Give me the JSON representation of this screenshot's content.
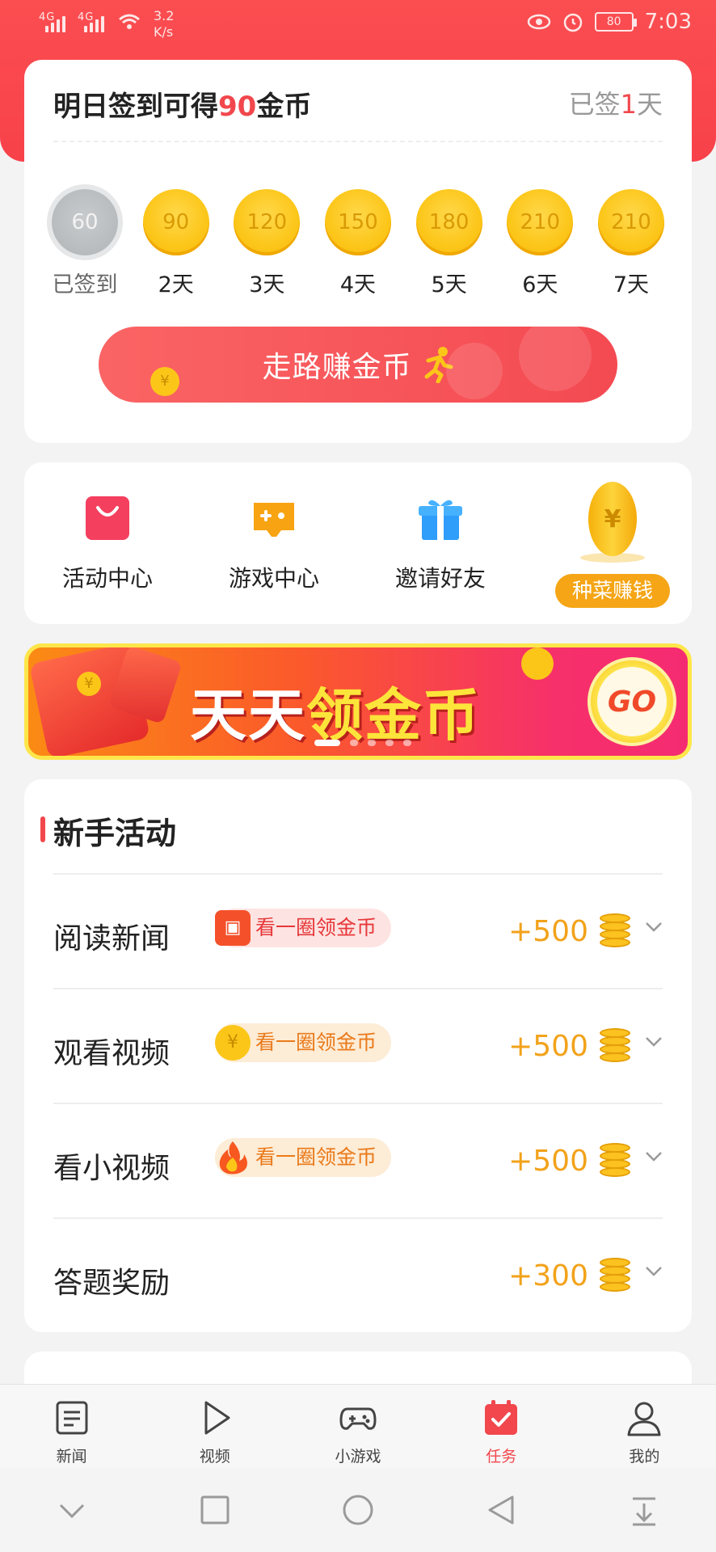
{
  "status": {
    "net1": "4G",
    "net2": "4G",
    "speed_value": "3.2",
    "speed_unit": "K/s",
    "battery": "80",
    "time": "7:03"
  },
  "signin": {
    "title_prefix": "明日签到可得",
    "title_amount": "90",
    "title_suffix": "金币",
    "signed_prefix": "已签",
    "signed_days": "1",
    "signed_suffix": "天",
    "days": [
      {
        "coins": "60",
        "label": "已签到",
        "done": true
      },
      {
        "coins": "90",
        "label": "2天"
      },
      {
        "coins": "120",
        "label": "3天"
      },
      {
        "coins": "150",
        "label": "4天"
      },
      {
        "coins": "180",
        "label": "5天"
      },
      {
        "coins": "210",
        "label": "6天"
      },
      {
        "coins": "210",
        "label": "7天"
      }
    ],
    "walk_button": "走路赚金币"
  },
  "quick": {
    "activity": "活动中心",
    "games": "游戏中心",
    "invite": "邀请好友",
    "farm": "种菜赚钱"
  },
  "banner": {
    "title_a": "天天",
    "title_b": "领金币",
    "go": "GO",
    "slides": 5,
    "active_slide": 1
  },
  "tasks": {
    "heading": "新手活动",
    "items": [
      {
        "name": "阅读新闻",
        "tag": "看一圈领金币",
        "reward": "+500"
      },
      {
        "name": "观看视频",
        "tag": "看一圈领金币",
        "reward": "+500"
      },
      {
        "name": "看小视频",
        "tag": "看一圈领金币",
        "reward": "+500"
      },
      {
        "name": "答题奖励",
        "tag": "",
        "reward": "+300"
      }
    ]
  },
  "tabs": {
    "news": "新闻",
    "video": "视频",
    "games": "小游戏",
    "tasks": "任务",
    "me": "我的",
    "active": "tasks"
  },
  "colors": {
    "accent": "#f1474d",
    "gold": "#f2a21a",
    "header": "#fb4e51"
  }
}
